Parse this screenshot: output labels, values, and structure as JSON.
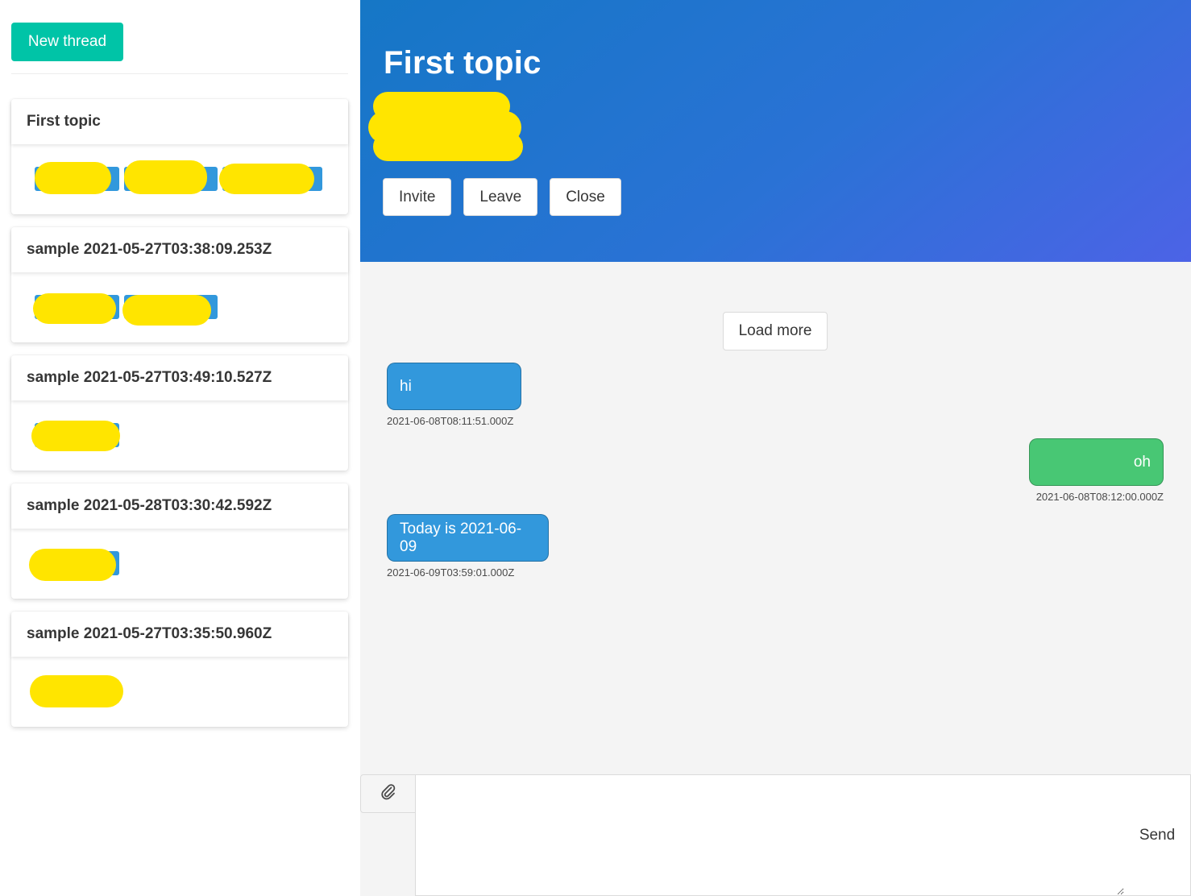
{
  "sidebar": {
    "new_thread_label": "New thread",
    "threads": [
      {
        "title": "First topic"
      },
      {
        "title": "sample 2021-05-27T03:38:09.253Z"
      },
      {
        "title": "sample 2021-05-27T03:49:10.527Z"
      },
      {
        "title": "sample 2021-05-28T03:30:42.592Z"
      },
      {
        "title": "sample 2021-05-27T03:35:50.960Z"
      }
    ]
  },
  "header": {
    "title": "First topic",
    "buttons": {
      "invite": "Invite",
      "leave": "Leave",
      "close": "Close"
    }
  },
  "chat": {
    "load_more_label": "Load more",
    "messages": [
      {
        "text": "hi",
        "time": "2021-06-08T08:11:51.000Z",
        "side": "left"
      },
      {
        "text": "oh",
        "time": "2021-06-08T08:12:00.000Z",
        "side": "right"
      },
      {
        "text": "Today is 2021-06-09",
        "time": "2021-06-09T03:59:01.000Z",
        "side": "left"
      }
    ]
  },
  "composer": {
    "attach_icon": "paperclip-icon",
    "input_value": "",
    "send_label": "Send"
  },
  "colors": {
    "primary": "#00c4a7",
    "hero_gradient_start": "#1577c6",
    "hero_gradient_end": "#4c63e6",
    "incoming_bubble": "#3298dc",
    "outgoing_bubble": "#48c774",
    "redaction": "#ffe500"
  }
}
